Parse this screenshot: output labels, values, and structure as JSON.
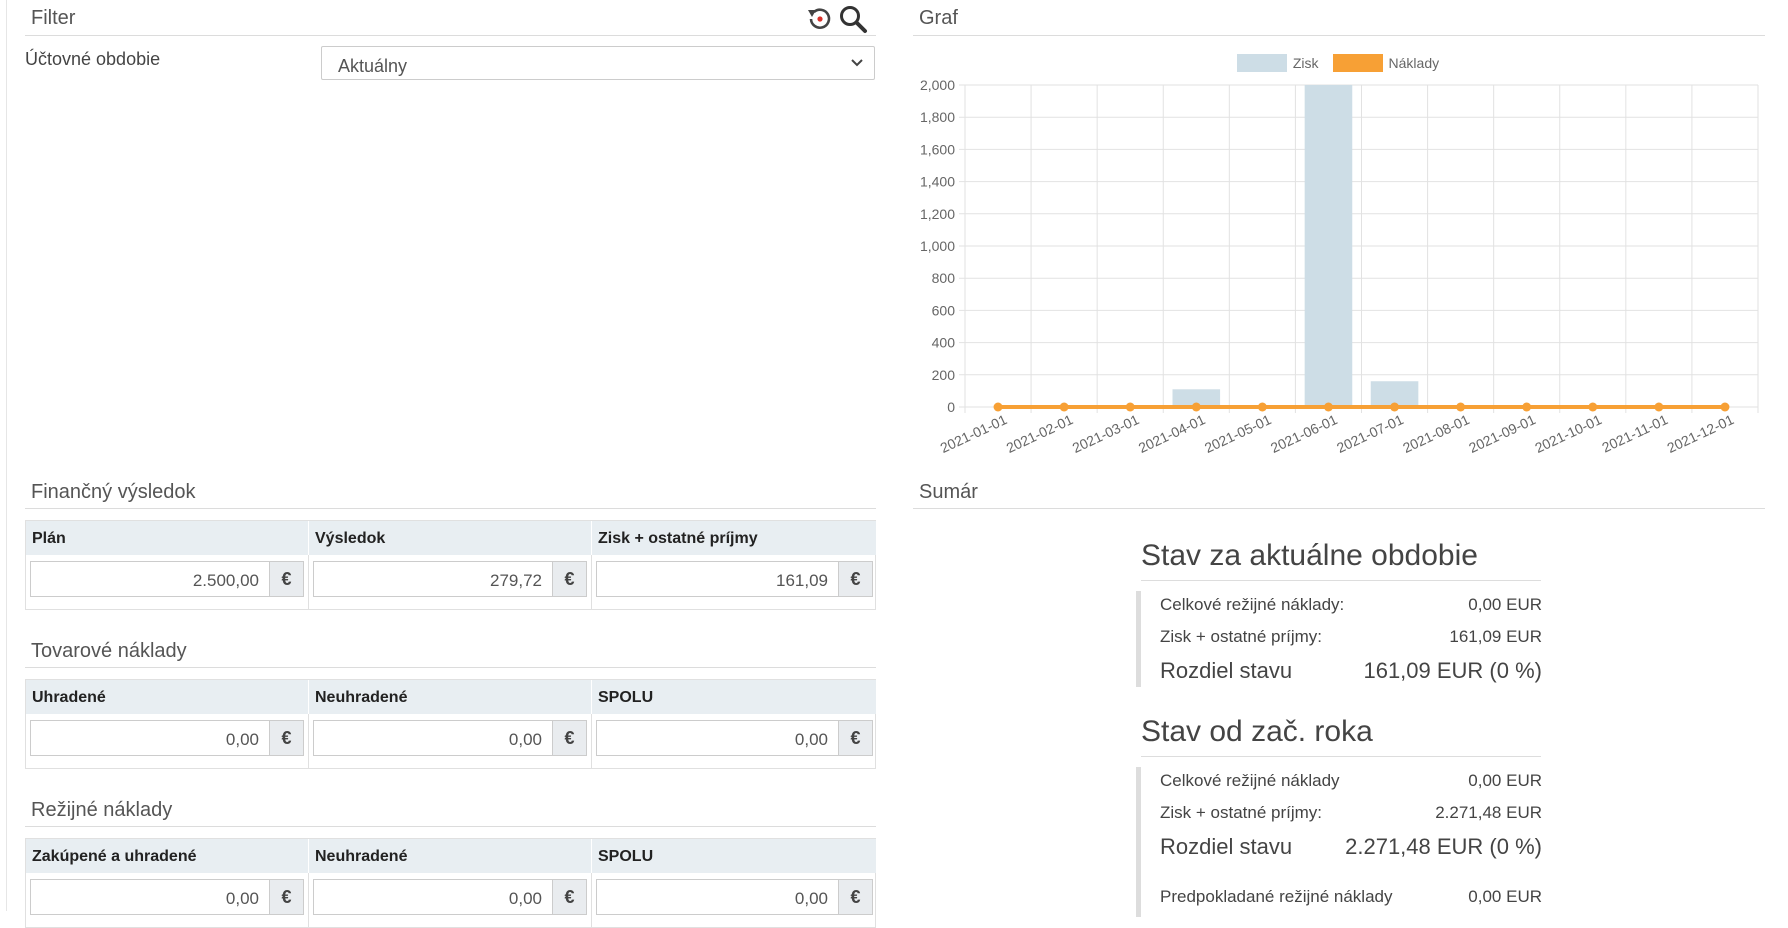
{
  "filter": {
    "title": "Filter",
    "period_label": "Účtovné obdobie",
    "period_value": "Aktuálny"
  },
  "financny": {
    "title": "Finančný výsledok",
    "headers": [
      "Plán",
      "Výsledok",
      "Zisk + ostatné príjmy"
    ],
    "values": [
      "2.500,00",
      "279,72",
      "161,09"
    ],
    "currency": "€"
  },
  "tovarove": {
    "title": "Tovarové náklady",
    "headers": [
      "Uhradené",
      "Neuhradené",
      "SPOLU"
    ],
    "values": [
      "0,00",
      "0,00",
      "0,00"
    ],
    "currency": "€"
  },
  "rezijne": {
    "title": "Režijné náklady",
    "headers": [
      "Zakúpené a uhradené",
      "Neuhradené",
      "SPOLU"
    ],
    "values": [
      "0,00",
      "0,00",
      "0,00"
    ],
    "currency": "€"
  },
  "graf": {
    "title": "Graf"
  },
  "chart_data": {
    "type": "bar",
    "categories": [
      "2021-01-01",
      "2021-02-01",
      "2021-03-01",
      "2021-04-01",
      "2021-05-01",
      "2021-06-01",
      "2021-07-01",
      "2021-08-01",
      "2021-09-01",
      "2021-10-01",
      "2021-11-01",
      "2021-12-01"
    ],
    "series": [
      {
        "name": "Zisk",
        "type": "bar",
        "color": "#cddde6",
        "values": [
          0,
          0,
          0,
          110,
          0,
          2000,
          160,
          0,
          0,
          0,
          0,
          0
        ]
      },
      {
        "name": "Náklady",
        "type": "line",
        "color": "#f7a035",
        "values": [
          0,
          0,
          0,
          0,
          0,
          0,
          0,
          0,
          0,
          0,
          0,
          0
        ]
      }
    ],
    "yticks": [
      "0",
      "200",
      "400",
      "600",
      "800",
      "1,000",
      "1,200",
      "1,400",
      "1,600",
      "1,800",
      "2,000"
    ],
    "ylim": [
      0,
      2000
    ],
    "legend_position": "top-center",
    "grid": true
  },
  "sumar": {
    "title": "Sumár",
    "current": {
      "heading": "Stav za aktuálne obdobie",
      "rows": [
        {
          "label": "Celkové režijné náklady:",
          "value": "0,00 EUR"
        },
        {
          "label": "Zisk + ostatné príjmy:",
          "value": "161,09 EUR"
        }
      ],
      "diff_label": "Rozdiel stavu",
      "diff_value": "161,09 EUR (0 %)"
    },
    "year": {
      "heading": "Stav od zač. roka",
      "rows": [
        {
          "label": "Celkové režijné náklady",
          "value": "0,00 EUR"
        },
        {
          "label": "Zisk + ostatné príjmy:",
          "value": "2.271,48 EUR"
        }
      ],
      "diff_label": "Rozdiel stavu",
      "diff_value": "2.271,48 EUR (0 %)",
      "expected_label": "Predpokladané režijné náklady",
      "expected_value": "0,00 EUR"
    }
  },
  "icons": {
    "reset": "reset-icon",
    "search": "search-icon",
    "currency": "euro-symbol"
  }
}
